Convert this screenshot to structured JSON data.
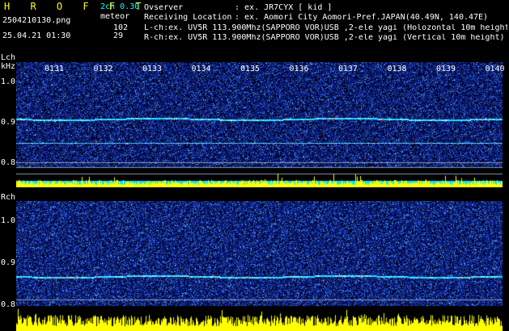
{
  "header": {
    "app_title": "H R O F F T",
    "channel_mode": "2ch 0.30",
    "mode": "meteor",
    "filename": "2504210130.png",
    "datetime": "25.04.21 01:30",
    "count_l": "102",
    "count_r": "29",
    "observer_label": "Ovserver",
    "observer_value": ": ex. JR7CYX [ kid ]",
    "location_label": "Receiving Location",
    "location_value": ": ex. Aomori City Aomori-Pref.JAPAN(40.49N, 140.47E)",
    "lch_line": "L-ch:ex. UV5R 113.900Mhz(SAPPORO VOR)USB ,2-ele yagi (Holozontal 10m height)",
    "rch_line": "R-ch:ex. UV5R 113.900Mhz(SAPPORO VOR)USB ,2-ele yagi (Vertical 10m height)"
  },
  "colors": {
    "title": "#ffff00",
    "channel_mode": "#00ffff",
    "header_text": "#ffffff",
    "background": "#000000",
    "spectrogram_noise": "#1a2fa0",
    "signal_trace": "#00ffff",
    "amplitude_fill": "#ffff00",
    "amplitude_cyan": "#00e5ff"
  },
  "lch_panel": {
    "label": "Lch",
    "unit": "kHz",
    "yticks": [
      "1.0",
      "0.9",
      "0.8"
    ],
    "minute_ticks": [
      "0131",
      "0132",
      "0133",
      "0134",
      "0135",
      "0136",
      "0137",
      "0138",
      "0139",
      "0140"
    ]
  },
  "rch_panel": {
    "label": "Rch",
    "yticks": [
      "1.0",
      "0.9",
      "0.8"
    ]
  }
}
